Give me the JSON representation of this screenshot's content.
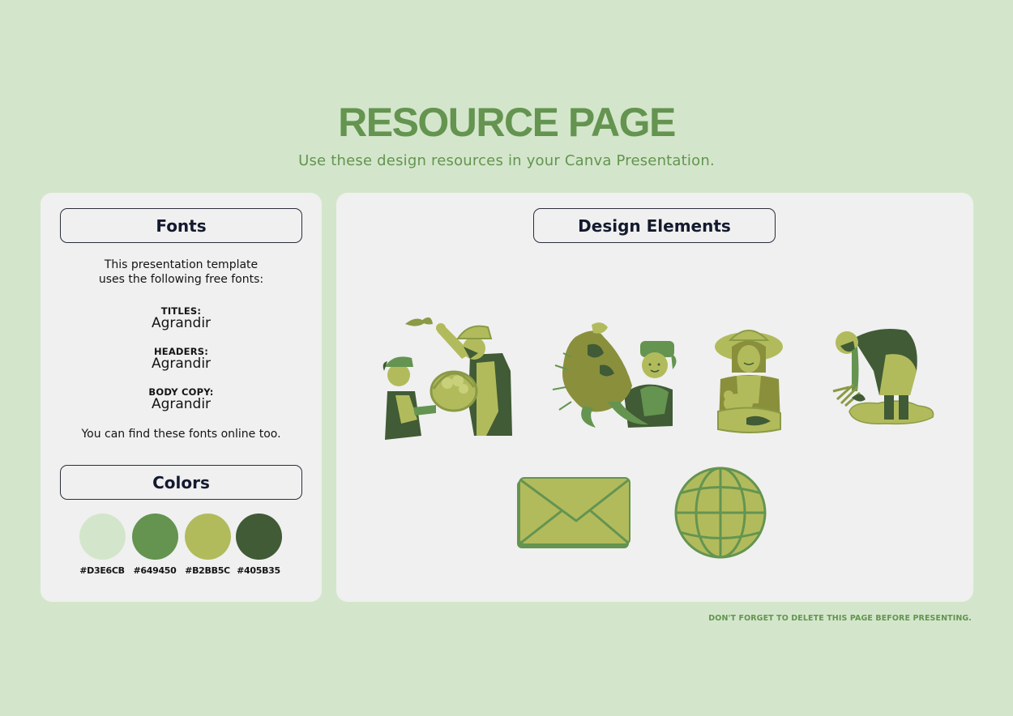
{
  "header": {
    "title": "RESOURCE PAGE",
    "subtitle": "Use these design resources in your Canva Presentation."
  },
  "fonts_card": {
    "heading": "Fonts",
    "intro_line1": "This presentation template",
    "intro_line2": "uses the following free fonts:",
    "entries": [
      {
        "label": "TITLES:",
        "font": "Agrandir"
      },
      {
        "label": "HEADERS:",
        "font": "Agrandir"
      },
      {
        "label": "BODY COPY:",
        "font": "Agrandir"
      }
    ],
    "outro": "You can find these fonts online too."
  },
  "colors_card": {
    "heading": "Colors",
    "swatches": [
      {
        "hex": "#D3E6CB",
        "label": "#D3E6CB"
      },
      {
        "hex": "#649450",
        "label": "#649450"
      },
      {
        "hex": "#B2BB5C",
        "label": "#B2BB5C"
      },
      {
        "hex": "#405B35",
        "label": "#405B35"
      }
    ]
  },
  "design_card": {
    "heading": "Design Elements",
    "elements": [
      {
        "icon": "farmers-with-basket-illustration"
      },
      {
        "icon": "child-with-rooster-illustration"
      },
      {
        "icon": "woman-with-chicken-illustration"
      },
      {
        "icon": "farmer-planting-illustration"
      },
      {
        "icon": "envelope-icon"
      },
      {
        "icon": "globe-icon"
      }
    ]
  },
  "footer": {
    "note": "DON'T FORGET TO DELETE THIS PAGE BEFORE PRESENTING."
  },
  "palette": {
    "background": "#D3E6CB",
    "card": "#F0F0F0",
    "accent": "#649450",
    "olive": "#B2BB5C",
    "dark": "#405B35"
  }
}
